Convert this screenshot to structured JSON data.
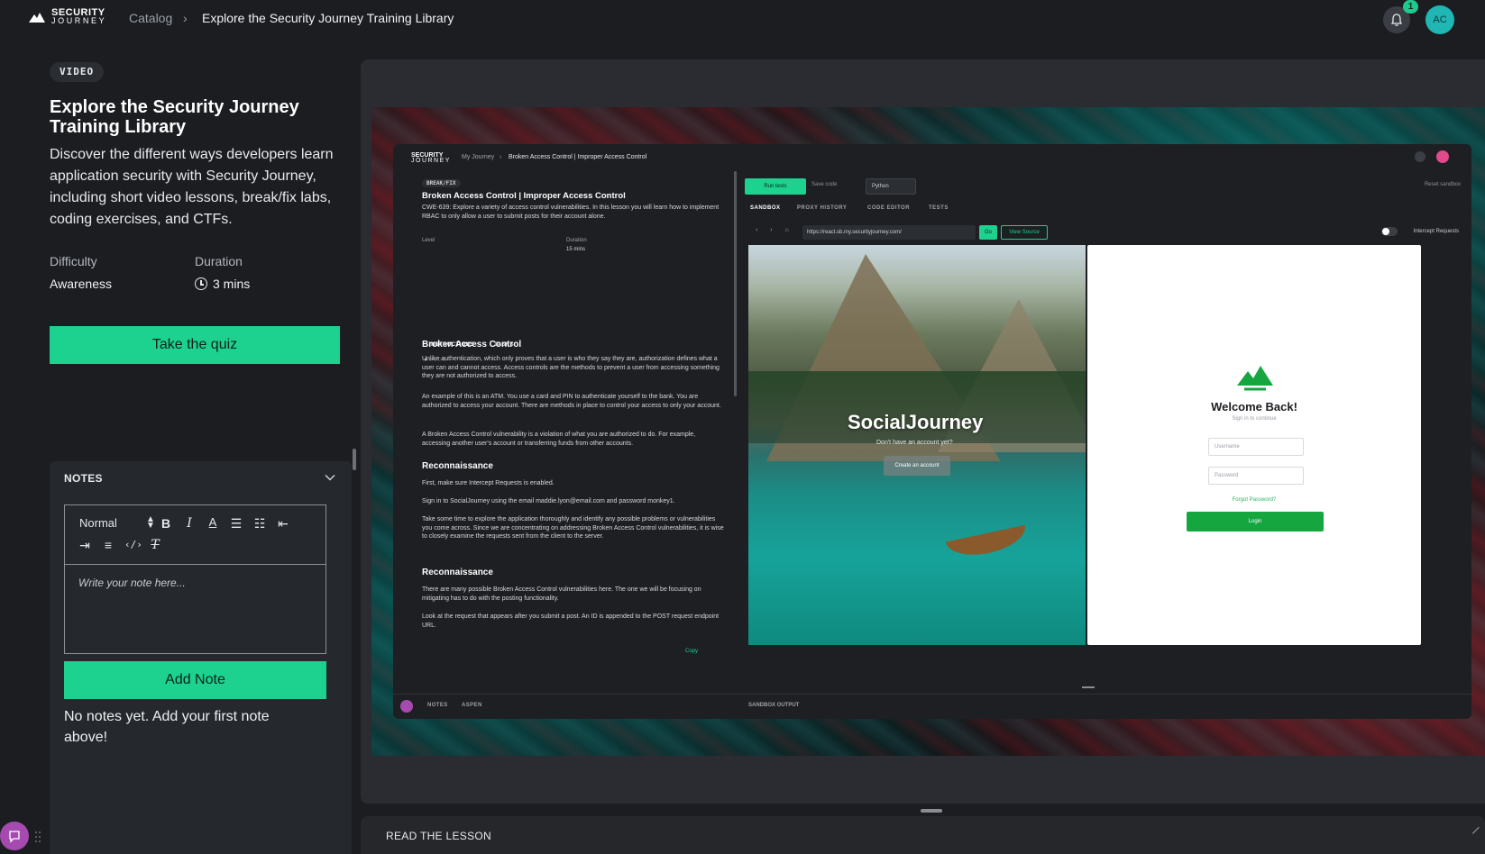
{
  "header": {
    "brand_line1": "SECURITY",
    "brand_line2": "JOURNEY",
    "breadcrumb_catalog": "Catalog",
    "breadcrumb_separator": "›",
    "breadcrumb_current": "Explore the Security Journey Training Library",
    "notification_count": "1",
    "avatar_initials": "AC"
  },
  "lesson": {
    "type_tag": "VIDEO",
    "title": "Explore the Security Journey Training Library",
    "description": "Discover the different ways developers learn application security with Security Journey, including short video lessons, break/fix labs, coding exercises, and CTFs.",
    "difficulty_label": "Difficulty",
    "difficulty_value": "Awareness",
    "duration_label": "Duration",
    "duration_value": "3 mins",
    "quiz_button": "Take the quiz"
  },
  "notes": {
    "heading": "NOTES",
    "format_select": "Normal",
    "placeholder": "Write your note here...",
    "add_button": "Add Note",
    "empty_message": "No notes yet. Add your first note above!"
  },
  "read_lesson": {
    "label": "READ THE LESSON"
  },
  "video": {
    "inner_header": {
      "brand_line1": "SECURITY",
      "brand_line2": "JOURNEY",
      "crumb_1": "My Journey",
      "crumb_sep": "›",
      "crumb_2": "Broken Access Control | Improper Access Control"
    },
    "instructions": {
      "tag": "BREAK/FIX",
      "title": "Broken Access Control | Improper Access Control",
      "intro": "CWE-639: Explore a variety of access control vulnerabilities. In this lesson you will learn how to implement RBAC to only allow a user to submit posts for their account alone.",
      "level_label": "Level",
      "duration_label": "Duration",
      "duration_value": "15 mins",
      "tab_instructions": "INSTRUCTIONS",
      "tab_tasks": "TASKS",
      "section1_title": "Broken Access Control",
      "section1_p1": "Unlike authentication, which only proves that a user is who they say they are, authorization defines what a user can and cannot access. Access controls are the methods to prevent a user from accessing something they are not authorized to access.",
      "section1_p2": "An example of this is an ATM. You use a card and PIN to authenticate yourself to the bank. You are authorized to access your account. There are methods in place to control your access to only your account.",
      "section1_p3": "A Broken Access Control vulnerability is a violation of what you are authorized to do. For example, accessing another user's account or transferring funds from other accounts.",
      "section2_title": "Reconnaissance",
      "section2_p1": "First, make sure Intercept Requests is enabled.",
      "section2_p2": "Sign in to SocialJourney using the email maddie.lyon@email.com and password monkey1.",
      "section2_p3": "Take some time to explore the application thoroughly and identify any possible problems or vulnerabilities you come across. Since we are concentrating on addressing Broken Access Control vulnerabilities, it is wise to closely examine the requests sent from the client to the server.",
      "section3_title": "Reconnaissance",
      "section3_p1": "There are many possible Broken Access Control vulnerabilities here. The one we will be focusing on mitigating has to do with the posting functionality.",
      "section3_p2": "Look at the request that appears after you submit a post. An ID is appended to the POST request endpoint URL.",
      "copy_label": "Copy",
      "bottom_notes": "NOTES",
      "bottom_aspen": "ASPEN"
    },
    "sandbox": {
      "run_tests": "Run tests",
      "save_code": "Save code",
      "language": "Python",
      "reset": "Reset sandbox",
      "tab_sandbox": "SANDBOX",
      "tab_proxy": "PROXY HISTORY",
      "tab_code": "CODE EDITOR",
      "tab_tests": "TESTS",
      "url": "https://react.sb.my.securityjourney.com/",
      "go": "Go",
      "view_source": "View Source",
      "intercept": "Intercept Requests",
      "app_title": "SocialJourney",
      "app_sub": "Don't have an account yet?",
      "create_account": "Create an account",
      "login_title": "Welcome Back!",
      "login_sub": "Sign in to continue",
      "username_placeholder": "Username",
      "password_placeholder": "Password",
      "forgot": "Forgot Password?",
      "login_button": "Login",
      "output_label": "SANDBOX OUTPUT"
    }
  }
}
